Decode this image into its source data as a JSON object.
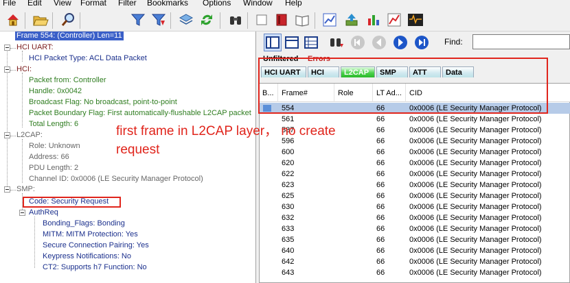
{
  "menu": [
    "File",
    "Edit",
    "View",
    "Format",
    "Filter",
    "Bookmarks",
    "Options",
    "Window",
    "Help"
  ],
  "toolbar_icons": [
    "home-icon",
    "folder-open-icon",
    "magnifier-icon",
    "filter-icon",
    "filter-add-icon",
    "layers-icon",
    "refresh-icon",
    "binoculars-icon",
    "book-red-icon",
    "book-open-icon",
    "chart-icon",
    "export-icon",
    "bar-chart-icon",
    "line-chart-icon",
    "event-summary-icon"
  ],
  "tree": {
    "root": "Frame 554: (Controller) Len=11",
    "hci_uart": {
      "label": "HCI UART:",
      "children": [
        "HCI Packet Type: ACL Data Packet"
      ]
    },
    "hci": {
      "label": "HCI:",
      "children": [
        "Packet from: Controller",
        "Handle: 0x0042",
        "Broadcast Flag: No broadcast, point-to-point",
        "Packet Boundary Flag: First automatically-flushable L2CAP packet",
        "Total Length: 6"
      ]
    },
    "l2cap": {
      "label": "L2CAP:",
      "children": [
        "Role: Unknown",
        "Address: 66",
        "PDU Length: 2",
        "Channel ID: 0x0006  (LE Security Manager Protocol)"
      ]
    },
    "smp": {
      "label": "SMP:",
      "code": "Code: Security Request",
      "authreq": "AuthReq",
      "authreq_children": [
        "Bonding_Flags: Bonding",
        "MITM: MITM Protection:  Yes",
        "Secure Connection Pairing: Yes",
        "Keypress Notifications: No",
        "CT2: Supports h7 Function: No"
      ]
    }
  },
  "annotation": {
    "line1": "first frame in L2CAP layer， no create",
    "line2": "request"
  },
  "find": {
    "label": "Find:",
    "value": ""
  },
  "filter_tabs": {
    "unfiltered": "Unfiltered",
    "errors": "Errors"
  },
  "layer_tabs": [
    "HCI UART",
    "HCI",
    "L2CAP",
    "SMP",
    "ATT",
    "Data"
  ],
  "active_layer": "L2CAP",
  "columns": [
    "B...",
    "Frame#",
    "Role",
    "LT Ad...",
    "CID"
  ],
  "rows": [
    {
      "frame": "554",
      "role": "",
      "lt": "66",
      "cid": "0x0006  (LE Security Manager Protocol)"
    },
    {
      "frame": "561",
      "role": "",
      "lt": "66",
      "cid": "0x0006  (LE Security Manager Protocol)"
    },
    {
      "frame": "587",
      "role": "",
      "lt": "66",
      "cid": "0x0006  (LE Security Manager Protocol)"
    },
    {
      "frame": "596",
      "role": "",
      "lt": "66",
      "cid": "0x0006  (LE Security Manager Protocol)"
    },
    {
      "frame": "600",
      "role": "",
      "lt": "66",
      "cid": "0x0006  (LE Security Manager Protocol)"
    },
    {
      "frame": "620",
      "role": "",
      "lt": "66",
      "cid": "0x0006  (LE Security Manager Protocol)"
    },
    {
      "frame": "622",
      "role": "",
      "lt": "66",
      "cid": "0x0006  (LE Security Manager Protocol)"
    },
    {
      "frame": "623",
      "role": "",
      "lt": "66",
      "cid": "0x0006  (LE Security Manager Protocol)"
    },
    {
      "frame": "625",
      "role": "",
      "lt": "66",
      "cid": "0x0006  (LE Security Manager Protocol)"
    },
    {
      "frame": "630",
      "role": "",
      "lt": "66",
      "cid": "0x0006  (LE Security Manager Protocol)"
    },
    {
      "frame": "632",
      "role": "",
      "lt": "66",
      "cid": "0x0006  (LE Security Manager Protocol)"
    },
    {
      "frame": "633",
      "role": "",
      "lt": "66",
      "cid": "0x0006  (LE Security Manager Protocol)"
    },
    {
      "frame": "635",
      "role": "",
      "lt": "66",
      "cid": "0x0006  (LE Security Manager Protocol)"
    },
    {
      "frame": "640",
      "role": "",
      "lt": "66",
      "cid": "0x0006  (LE Security Manager Protocol)"
    },
    {
      "frame": "642",
      "role": "",
      "lt": "66",
      "cid": "0x0006  (LE Security Manager Protocol)"
    },
    {
      "frame": "643",
      "role": "",
      "lt": "66",
      "cid": "0x0006  (LE Security Manager Protocol)"
    }
  ],
  "colors": {
    "annotation": "#e0241b",
    "selection": "#b6cbe8",
    "tree_green": "#2f7d20",
    "tree_blue": "#1a2f8c",
    "active_tab": "#2ab82a"
  }
}
